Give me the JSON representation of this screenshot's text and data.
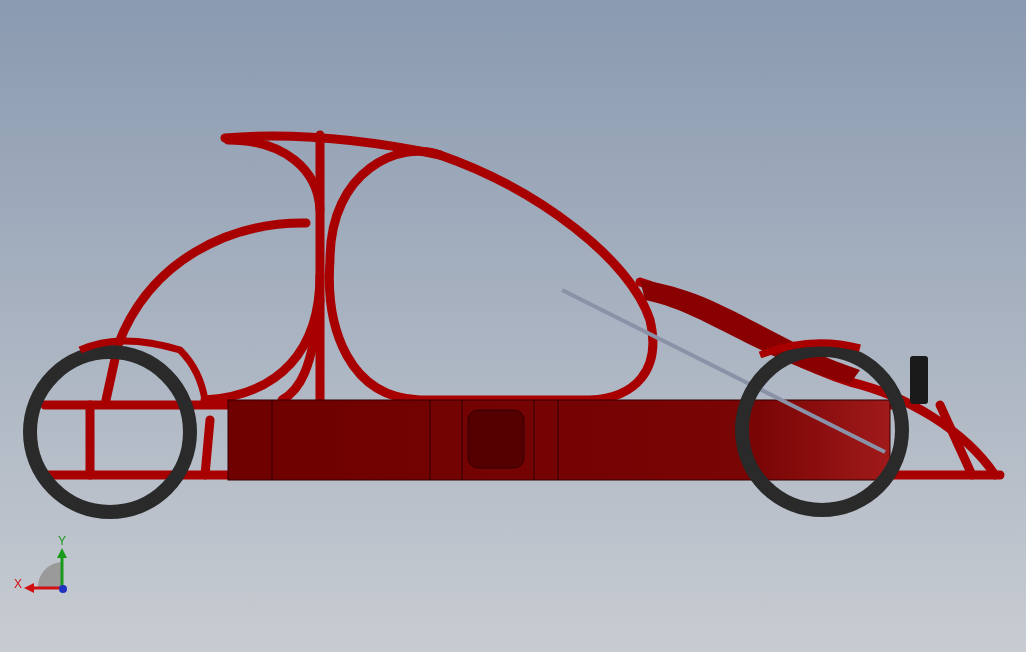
{
  "viewport": {
    "triad": {
      "axes": [
        {
          "kind": "y",
          "label": "Y"
        },
        {
          "kind": "x",
          "label": "X"
        }
      ]
    }
  }
}
